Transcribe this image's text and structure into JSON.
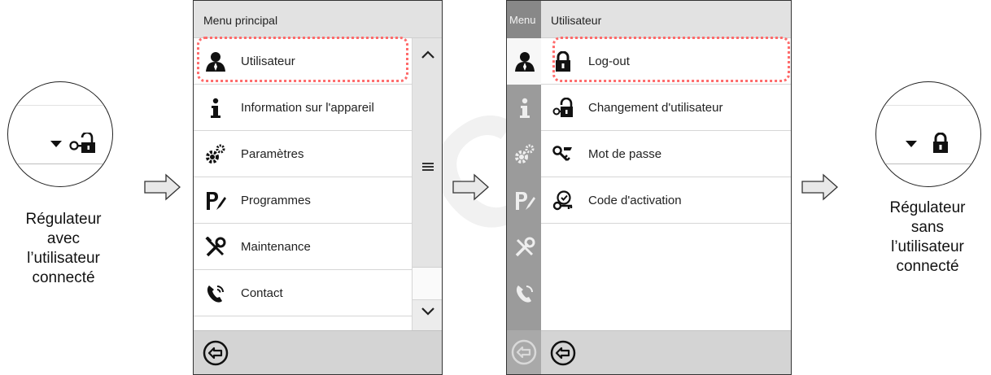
{
  "left_caption": [
    "Régulateur",
    "avec",
    "l’utilisateur",
    "connecté"
  ],
  "right_caption": [
    "Régulateur",
    "sans",
    "l’utilisateur",
    "connecté"
  ],
  "panel1": {
    "title": "Menu principal",
    "items": [
      {
        "label": "Utilisateur",
        "icon": "user-icon",
        "highlighted": true
      },
      {
        "label": "Information sur l'appareil",
        "icon": "info-icon"
      },
      {
        "label": "Paramètres",
        "icon": "gears-icon"
      },
      {
        "label": "Programmes",
        "icon": "programs-icon"
      },
      {
        "label": "Maintenance",
        "icon": "maintenance-icon"
      },
      {
        "label": "Contact",
        "icon": "phone-icon"
      }
    ],
    "scroll_up": "^",
    "scroll_mid": "≡",
    "scroll_down": "v"
  },
  "panel2": {
    "sidebar_title": "Menu",
    "title": "Utilisateur",
    "items": [
      {
        "label": "Log-out",
        "icon": "lock-closed-icon",
        "highlighted": true
      },
      {
        "label": "Changement d'utilisateur",
        "icon": "lock-key-icon"
      },
      {
        "label": "Mot de passe",
        "icon": "key-icon"
      },
      {
        "label": "Code d'activation",
        "icon": "activation-code-icon"
      }
    ]
  },
  "colors": {
    "highlight": "#ff6b6b",
    "header": "#e2e2e2",
    "footer": "#d4d4d4",
    "sidebar": "#9b9b9b"
  }
}
